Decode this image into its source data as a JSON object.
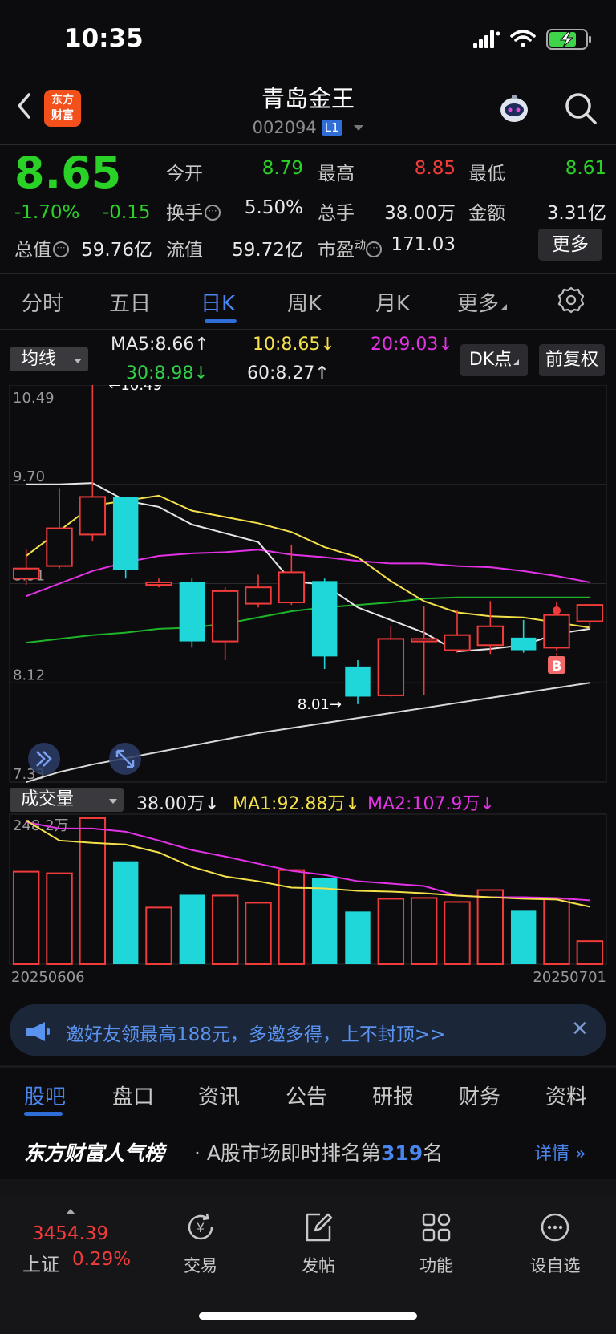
{
  "status": {
    "time": "10:35"
  },
  "header": {
    "name": "青岛金王",
    "code": "002094",
    "level": "L1",
    "logo_line1": "东方",
    "logo_line2": "财富"
  },
  "quote": {
    "price": "8.65",
    "change_pct": "-1.70%",
    "change_amt": "-0.15",
    "open_label": "今开",
    "open": "8.79",
    "high_label": "最高",
    "high": "8.85",
    "low_label": "最低",
    "low": "8.61",
    "turnover_label": "换手",
    "turnover": "5.50%",
    "volume_label": "总手",
    "volume": "38.00万",
    "amount_label": "金额",
    "amount": "3.31亿",
    "total_mv_label": "总值",
    "total_mv": "59.76亿",
    "float_mv_label": "流值",
    "float_mv": "59.72亿",
    "pe_label": "市盈",
    "pe_sup": "动",
    "pe": "171.03",
    "more": "更多"
  },
  "tabs": [
    "分时",
    "五日",
    "日K",
    "周K",
    "月K",
    "更多"
  ],
  "ma_row": {
    "dropdown": "均线",
    "ma5": "MA5:8.66↑",
    "ma10": "10:8.65↓",
    "ma20": "20:9.03↓",
    "ma30": "30:8.98↓",
    "ma60": "60:8.27↑",
    "dk": "DK点",
    "fq": "前复权"
  },
  "vol_row": {
    "dropdown": "成交量",
    "vol": "38.00万↓",
    "ma1": "MA1:92.88万↓",
    "ma2": "MA2:107.9万↓"
  },
  "colors": {
    "up": "#f23b3b",
    "down": "#1fd6d9",
    "ma5": "#e6e6e6",
    "ma10": "#f4e14a",
    "ma20": "#e432e6",
    "ma30": "#1fb52a",
    "ma60": "#d8d8d8",
    "accent": "#2f6ed8"
  },
  "chart_data": {
    "type": "candlestick",
    "y_ticks": [
      "10.49",
      "9.70",
      "8.91",
      "8.12",
      "7.33"
    ],
    "ylim": [
      7.33,
      10.49
    ],
    "max_label": "←10.49",
    "min_label": "8.01→",
    "vol_max_label": "248.2万",
    "start_date": "20250606",
    "end_date": "20250701",
    "signal_label": "B",
    "candles": [
      {
        "o": 8.95,
        "c": 9.03,
        "h": 9.18,
        "l": 8.9
      },
      {
        "o": 9.05,
        "c": 9.35,
        "h": 9.67,
        "l": 9.03
      },
      {
        "o": 9.3,
        "c": 9.6,
        "h": 10.49,
        "l": 9.25
      },
      {
        "o": 9.6,
        "c": 9.02,
        "h": 9.6,
        "l": 8.95
      },
      {
        "o": 8.9,
        "c": 8.92,
        "h": 8.95,
        "l": 8.88
      },
      {
        "o": 8.92,
        "c": 8.45,
        "h": 8.95,
        "l": 8.4
      },
      {
        "o": 8.45,
        "c": 8.85,
        "h": 8.88,
        "l": 8.3
      },
      {
        "o": 8.75,
        "c": 8.88,
        "h": 8.98,
        "l": 8.72
      },
      {
        "o": 8.76,
        "c": 9.0,
        "h": 9.22,
        "l": 8.74
      },
      {
        "o": 8.93,
        "c": 8.33,
        "h": 8.95,
        "l": 8.23
      },
      {
        "o": 8.25,
        "c": 8.01,
        "h": 8.3,
        "l": 7.95
      },
      {
        "o": 8.02,
        "c": 8.47,
        "h": 8.57,
        "l": 8.01
      },
      {
        "o": 8.45,
        "c": 8.47,
        "h": 8.73,
        "l": 8.02
      },
      {
        "o": 8.38,
        "c": 8.5,
        "h": 8.7,
        "l": 8.36
      },
      {
        "o": 8.42,
        "c": 8.57,
        "h": 8.77,
        "l": 8.35
      },
      {
        "o": 8.48,
        "c": 8.38,
        "h": 8.62,
        "l": 8.36
      },
      {
        "o": 8.4,
        "c": 8.66,
        "h": 8.76,
        "l": 8.38
      },
      {
        "o": 8.61,
        "c": 8.74,
        "h": 8.74,
        "l": 8.55
      }
    ],
    "ma5": [
      9.7,
      9.7,
      9.71,
      9.57,
      9.52,
      9.38,
      9.31,
      9.24,
      8.93,
      8.9,
      8.72,
      8.62,
      8.52,
      8.37,
      8.39,
      8.42,
      8.51,
      8.55
    ],
    "ma10": [
      9.13,
      9.33,
      9.53,
      9.57,
      9.61,
      9.49,
      9.44,
      9.39,
      9.32,
      9.2,
      9.12,
      8.93,
      8.77,
      8.68,
      8.65,
      8.64,
      8.6,
      8.56
    ],
    "ma20": [
      8.81,
      8.91,
      9.01,
      9.08,
      9.13,
      9.15,
      9.16,
      9.18,
      9.14,
      9.12,
      9.09,
      9.07,
      9.07,
      9.05,
      9.04,
      9.01,
      8.97,
      8.92
    ],
    "ma30": [
      8.44,
      8.47,
      8.5,
      8.52,
      8.55,
      8.56,
      8.59,
      8.64,
      8.69,
      8.72,
      8.74,
      8.76,
      8.79,
      8.8,
      8.8,
      8.8,
      8.8,
      8.8
    ],
    "ma60": [
      7.33,
      7.41,
      7.47,
      7.52,
      7.57,
      7.62,
      7.67,
      7.72,
      7.76,
      7.8,
      7.84,
      7.88,
      7.92,
      7.96,
      8.0,
      8.04,
      8.08,
      8.12
    ],
    "volume": [
      1.16,
      1.14,
      1.83,
      1.29,
      0.71,
      0.87,
      0.86,
      0.77,
      1.18,
      1.08,
      0.66,
      0.82,
      0.83,
      0.78,
      0.93,
      0.67,
      0.82,
      0.29
    ],
    "vol_ma1": [
      1.8,
      1.55,
      1.52,
      1.5,
      1.4,
      1.22,
      1.1,
      1.04,
      0.96,
      0.95,
      0.92,
      0.91,
      0.89,
      0.86,
      0.84,
      0.82,
      0.81,
      0.72
    ],
    "vol_ma2": [
      1.78,
      1.7,
      1.7,
      1.66,
      1.55,
      1.43,
      1.35,
      1.26,
      1.17,
      1.12,
      1.04,
      1.01,
      0.98,
      0.86,
      0.84,
      0.84,
      0.83,
      0.8
    ]
  },
  "banner": {
    "text": "邀好友领最高188元，多邀多得，上不封顶>>"
  },
  "bottom_tabs": [
    "股吧",
    "盘口",
    "资讯",
    "公告",
    "研报",
    "财务",
    "资料"
  ],
  "rank": {
    "title": "东方财富人气榜",
    "prefix": "· A股市场即时排名第",
    "num": "319",
    "suffix": "名",
    "more": "详情"
  },
  "nav": {
    "index_value": "3454.39",
    "index_name": "上证",
    "index_pct": "0.29%",
    "items": [
      "交易",
      "发帖",
      "功能",
      "设自选"
    ]
  }
}
